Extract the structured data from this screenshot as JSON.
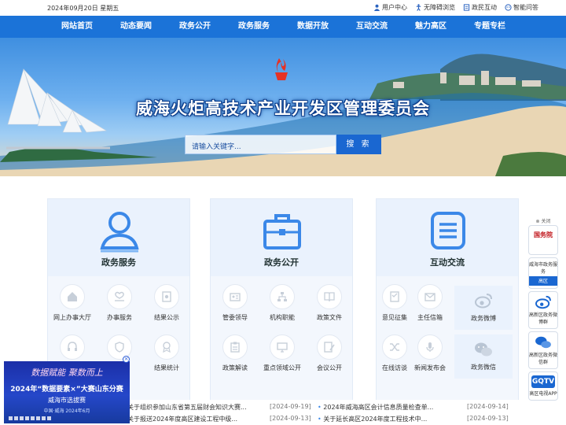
{
  "topbar": {
    "date": "2024年09月20日 星期五",
    "links": [
      "用户中心",
      "无障碍浏览",
      "政民互动",
      "智能问答"
    ]
  },
  "nav": [
    "网站首页",
    "动态要闻",
    "政务公开",
    "政务服务",
    "数据开放",
    "互动交流",
    "魅力高区",
    "专题专栏"
  ],
  "banner": {
    "title": "威海火炬高技术产业开发区管理委员会",
    "search_placeholder": "请输入关键字...",
    "search_button": "搜 索"
  },
  "cards": [
    {
      "title": "政务服务",
      "items": [
        "网上办事大厅",
        "办事服务",
        "结果公示",
        "",
        "",
        "结果统计"
      ]
    },
    {
      "title": "政务公开",
      "items": [
        "管委领导",
        "机构职能",
        "政策文件",
        "政策解读",
        "重点领域公开",
        "会议公开"
      ]
    },
    {
      "title": "互动交流",
      "items": [
        "意见征集",
        "主任信箱",
        "在线访谈",
        "新闻发布会"
      ],
      "tiles": [
        "政务微博",
        "政务微信"
      ]
    }
  ],
  "news": [
    {
      "title": "关于组织参加山东省第五届财会知识大赛...",
      "date": "[2024-09-19]"
    },
    {
      "title": "关于报送2024年度高区建设工程中级...",
      "date": "[2024-09-13]"
    },
    {
      "title": "2024年威海高区会计信息质量检查单...",
      "date": "[2024-09-14]"
    },
    {
      "title": "关于延长高区2024年度工程技术中...",
      "date": "[2024-09-13]"
    }
  ],
  "popup": {
    "line1": "数据赋能  聚数而上",
    "line2": "2024年“数据要素×”大赛山东分赛",
    "line3": "威海市选拔赛",
    "line4": "中国·威海  2024年6月"
  },
  "sidebar": {
    "close": "⊗ 关闭",
    "gov_app": "国务院",
    "city_app": "威海市政务服务",
    "city_app_badge": "高区",
    "weibo1": "高新区政务微博群",
    "weibo2": "高新区政务微信群",
    "tv_logo": "GQTV",
    "tv": "高区电视APP"
  },
  "colors": {
    "nav": "#1b73d8",
    "accent": "#1a67d1",
    "icon": "#3b88e8"
  }
}
